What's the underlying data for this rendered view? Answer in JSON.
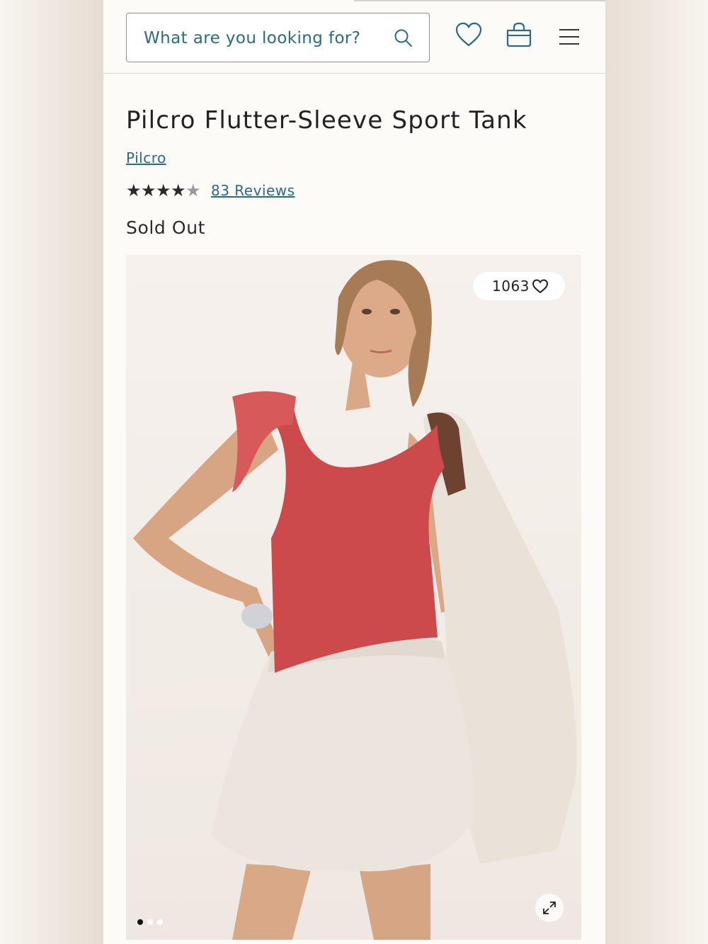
{
  "header": {
    "search_placeholder": "What are you looking for?",
    "icons": [
      "search-icon",
      "heart-icon",
      "shopping-bag-icon",
      "menu-icon"
    ]
  },
  "product": {
    "title": "Pilcro Flutter-Sleeve Sport Tank",
    "brand": "Pilcro",
    "rating": 4,
    "rating_max": 5,
    "reviews_label": "83 Reviews",
    "status": "Sold Out"
  },
  "gallery": {
    "like_count": "1063",
    "active_index": 0,
    "image_count": 3
  },
  "colors": {
    "link": "#2c6a7e",
    "star_filled": "#2a2a2a",
    "star_empty": "#9a9a9a",
    "tank_red": "#cc4a4c"
  }
}
